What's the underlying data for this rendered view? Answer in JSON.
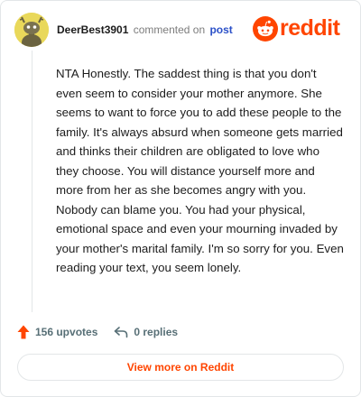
{
  "comment": {
    "username": "DeerBest3901",
    "commented_on": "commented on",
    "post_link": "post",
    "body": "NTA Honestly. The saddest thing is that you don't even seem to consider your mother anymore. She seems to want to force you to add these people to the family. It's always absurd when someone gets married and thinks their children are obligated to love who they choose. You will distance yourself more and more from her as she becomes angry with you. Nobody can blame you. You had your physical, emotional space and even your mourning invaded by your mother's marital family. I'm so sorry for you. Even reading your text, you seem lonely.",
    "upvotes": "156 upvotes",
    "replies": "0 replies"
  },
  "brand": {
    "logo_text": "reddit",
    "accent_color": "#ff4500"
  },
  "footer": {
    "view_more_label": "View more on Reddit"
  },
  "icons": {
    "avatar": "snoo-avatar-icon",
    "logo": "reddit-snoo-icon",
    "upvote": "upvote-arrow-icon",
    "reply": "reply-arrow-icon"
  }
}
